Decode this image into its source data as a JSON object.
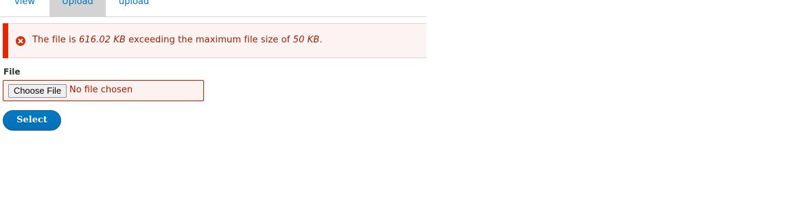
{
  "tabs": [
    {
      "label": "view"
    },
    {
      "label": "Upload",
      "active": true
    },
    {
      "label": "upload"
    }
  ],
  "message": {
    "type": "error",
    "icon": "error-icon",
    "prefix": "The file is ",
    "file_size": "616.02 KB",
    "middle": " exceeding the maximum file size of ",
    "max_size": "50 KB",
    "suffix": ".",
    "colors": {
      "background": "#fcf4f2",
      "accent_bar": "#e62600",
      "text": "#a51b00"
    }
  },
  "form": {
    "file_label": "File",
    "choose_file_button": "Choose File",
    "file_status": "No file chosen",
    "submit_label": "Select",
    "submit_color": "#0071b8"
  }
}
